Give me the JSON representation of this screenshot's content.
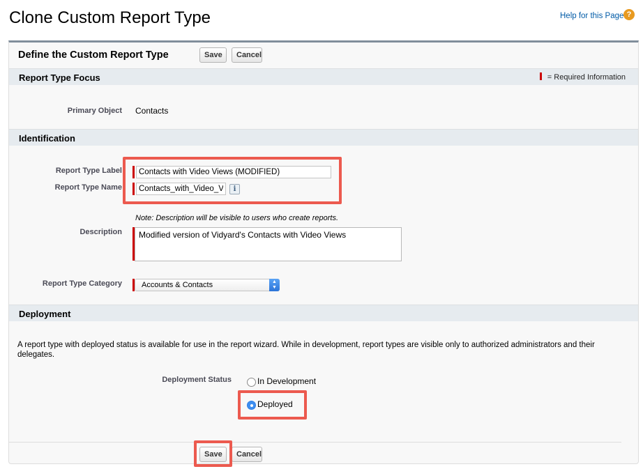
{
  "page": {
    "title": "Clone Custom Report Type",
    "help_link": "Help for this Page",
    "help_icon": "?"
  },
  "header": {
    "title": "Define the Custom Report Type",
    "save_label": "Save",
    "cancel_label": "Cancel"
  },
  "sections": {
    "focus": {
      "title": "Report Type Focus",
      "required_legend": "= Required Information",
      "primary_object_label": "Primary Object",
      "primary_object_value": "Contacts"
    },
    "identification": {
      "title": "Identification",
      "report_type_label_label": "Report Type Label",
      "report_type_label_value": "Contacts with Video Views (MODIFIED)",
      "report_type_name_label": "Report Type Name",
      "report_type_name_value": "Contacts_with_Video_Views_MODIFIED",
      "info_icon": "i",
      "description_note": "Note: Description will be visible to users who create reports.",
      "description_label": "Description",
      "description_value": "Modified version of Vidyard's Contacts with Video Views",
      "category_label": "Report Type Category",
      "category_value": "Accounts & Contacts"
    },
    "deployment": {
      "title": "Deployment",
      "description": "A report type with deployed status is available for use in the report wizard. While in development, report types are visible only to authorized administrators and their delegates.",
      "status_label": "Deployment Status",
      "options": [
        {
          "label": "In Development",
          "checked": false
        },
        {
          "label": "Deployed",
          "checked": true
        }
      ]
    }
  },
  "footer": {
    "save_label": "Save",
    "cancel_label": "Cancel"
  },
  "colors": {
    "highlight": "#ec5a4f",
    "required": "#cc0000",
    "section_bar": "#e6ebef"
  }
}
